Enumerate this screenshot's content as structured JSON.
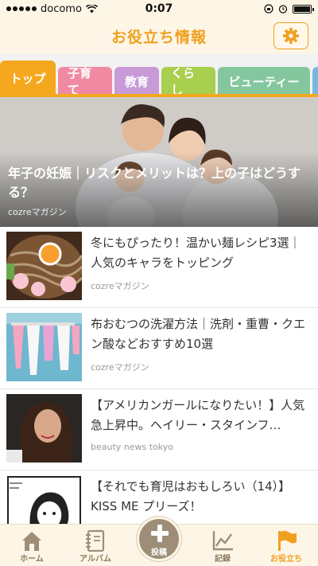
{
  "status_bar": {
    "carrier": "docomo",
    "time": "0:07"
  },
  "header": {
    "title": "お役立ち情報",
    "settings_icon": "gear-icon"
  },
  "tabs": [
    {
      "label": "トップ",
      "color": "#f5a81e",
      "active": true
    },
    {
      "label": "子育て",
      "color": "#f08aa2"
    },
    {
      "label": "教育",
      "color": "#c89ad8"
    },
    {
      "label": "くらし",
      "color": "#a8cf4e"
    },
    {
      "label": "ビューティー",
      "color": "#84c79f"
    }
  ],
  "hero": {
    "title": "年子の妊娠｜リスクとメリットは？上の子はどうする？",
    "source": "cozreマガジン"
  },
  "articles": [
    {
      "title": "冬にもぴったり！温かい麺レシピ3選｜人気のキャラをトッピング",
      "source": "cozreマガジン"
    },
    {
      "title": "布おむつの洗濯方法｜洗剤・重曹・クエン酸などおすすめ10選",
      "source": "cozreマガジン"
    },
    {
      "title": "【アメリカンガールになりたい！】人気急上昇中。ヘイリー・スタインフ…",
      "source": "beauty news tokyo"
    },
    {
      "title": "【それでも育児はおもしろい（14）】KISS ME プリーズ！",
      "source": ""
    }
  ],
  "bottom_nav": {
    "home": "ホーム",
    "album": "アルバム",
    "post": "投稿",
    "record": "記録",
    "useful": "お役立ち"
  },
  "colors": {
    "accent": "#f0a020",
    "nav_text": "#8c7b5c"
  }
}
